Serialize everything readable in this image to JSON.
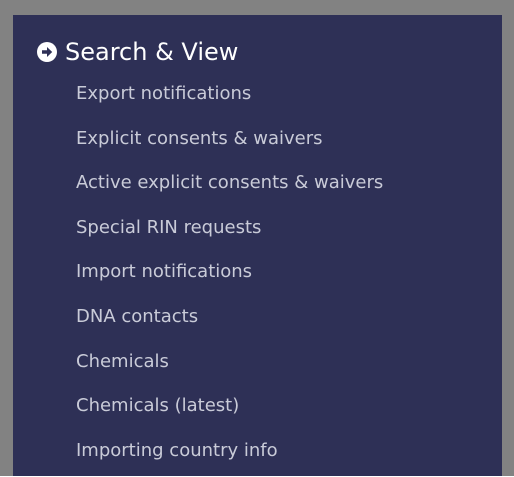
{
  "section": {
    "title": "Search & View",
    "icon": "circle-arrow-right-icon",
    "colors": {
      "panel_background": "#2e3056",
      "frame": "#828282",
      "heading_text": "#ffffff",
      "link_text": "#c9cbd8"
    },
    "items": [
      {
        "label": "Export notifications"
      },
      {
        "label": "Explicit consents & waivers"
      },
      {
        "label": "Active explicit consents & waivers"
      },
      {
        "label": "Special RIN requests"
      },
      {
        "label": "Import notifications"
      },
      {
        "label": "DNA contacts"
      },
      {
        "label": "Chemicals"
      },
      {
        "label": "Chemicals (latest)"
      },
      {
        "label": "Importing country info"
      }
    ]
  }
}
